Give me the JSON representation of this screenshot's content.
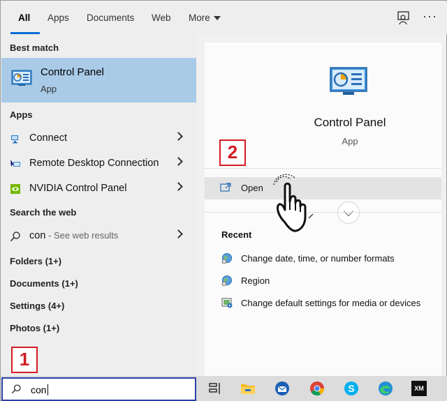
{
  "tabs": [
    {
      "label": "All"
    },
    {
      "label": "Apps"
    },
    {
      "label": "Documents"
    },
    {
      "label": "Web"
    },
    {
      "label": "More"
    }
  ],
  "left": {
    "best_match_heading": "Best match",
    "best_match": {
      "title": "Control Panel",
      "subtitle": "App"
    },
    "apps_heading": "Apps",
    "apps": [
      {
        "label": "Connect",
        "icon": "connect-icon"
      },
      {
        "label": "Remote Desktop Connection",
        "icon": "remote-desktop-icon"
      },
      {
        "label": "NVIDIA Control Panel",
        "icon": "nvidia-icon"
      }
    ],
    "web_heading": "Search the web",
    "web_result": {
      "query": "con",
      "suffix": " - See web results"
    },
    "categories": [
      {
        "label": "Folders (1+)"
      },
      {
        "label": "Documents (1+)"
      },
      {
        "label": "Settings (4+)"
      },
      {
        "label": "Photos (1+)"
      }
    ]
  },
  "right": {
    "title": "Control Panel",
    "subtitle": "App",
    "open_label": "Open",
    "recent_heading": "Recent",
    "recent": [
      {
        "label": "Change date, time, or number formats",
        "icon": "date-time-settings-icon"
      },
      {
        "label": "Region",
        "icon": "region-icon"
      },
      {
        "label": "Change default settings for media or devices",
        "icon": "autoplay-icon"
      }
    ]
  },
  "search": {
    "value": "con"
  },
  "badges": {
    "step1": "1",
    "step2": "2"
  },
  "taskbar_icons": [
    "task-view-icon",
    "file-explorer-icon",
    "thunderbird-icon",
    "chrome-icon",
    "skype-icon",
    "edge-icon",
    "xm-trading-icon"
  ],
  "colors": {
    "accent": "#0a6cd6",
    "selected_bg": "#a9cbe8",
    "badge_red": "#d31c24",
    "search_border": "#2b3fa8"
  }
}
